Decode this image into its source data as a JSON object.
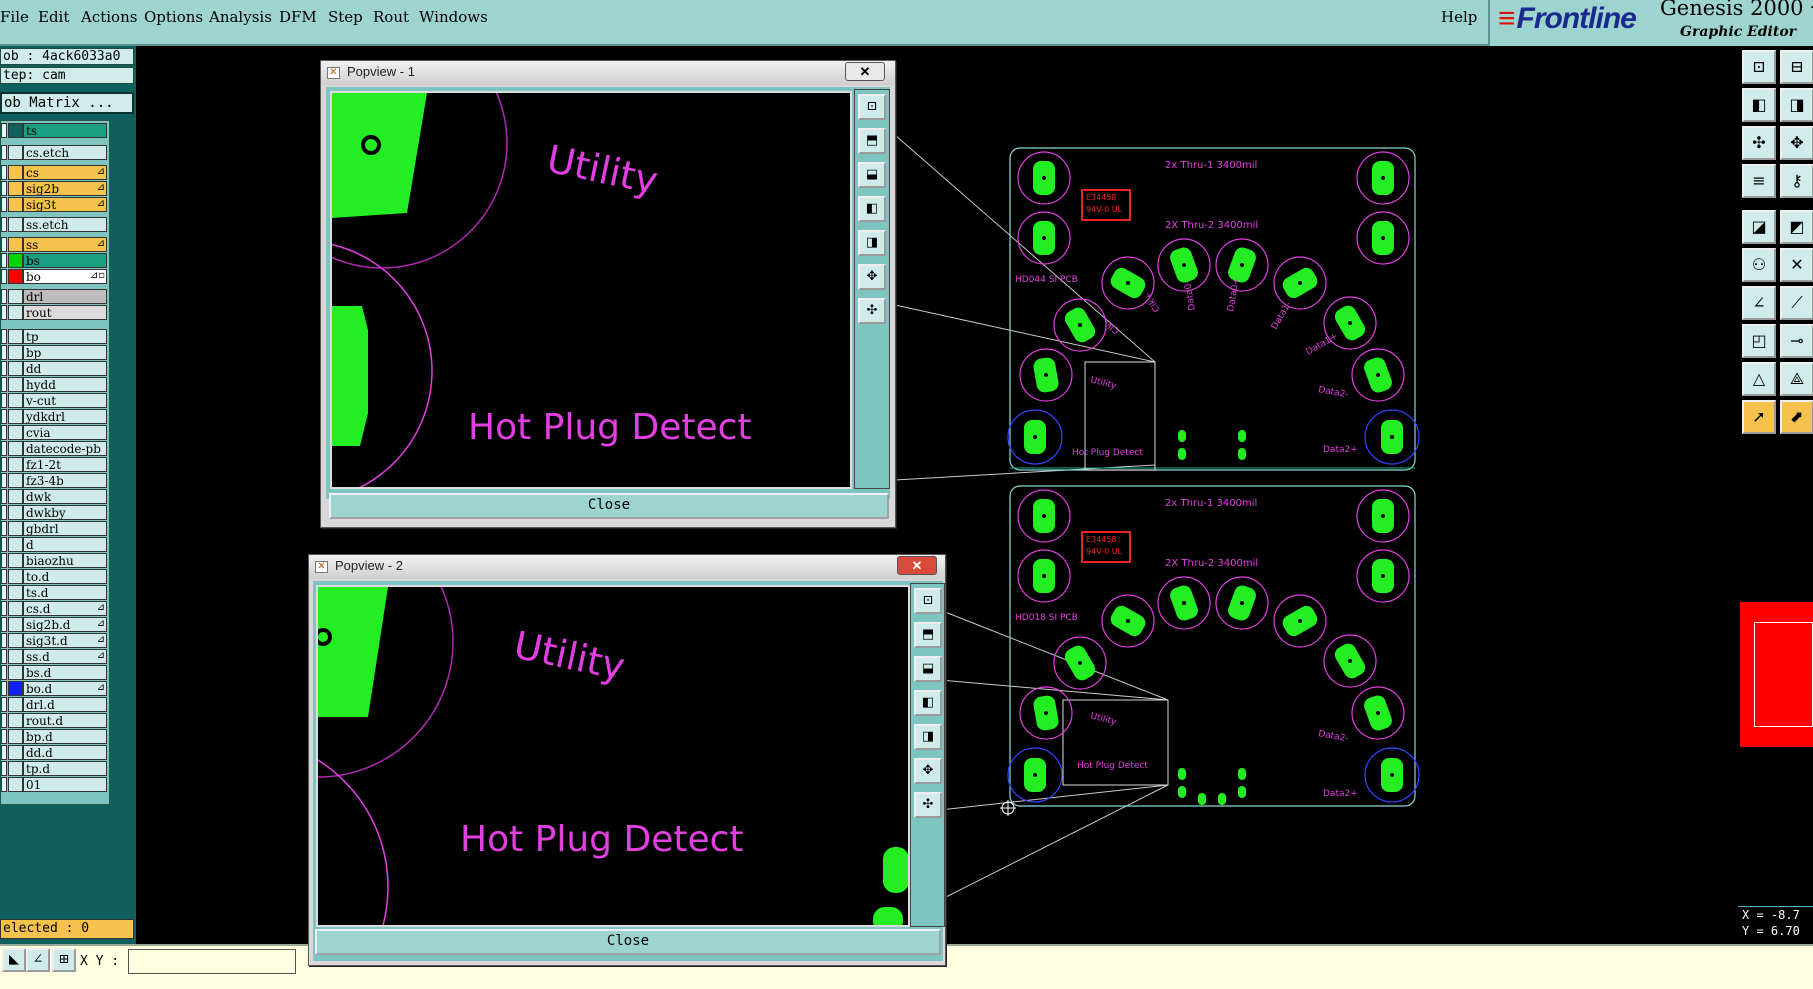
{
  "menu": {
    "items": [
      "File",
      "Edit",
      "Actions",
      "Options",
      "Analysis",
      "DFM",
      "Step",
      "Rout",
      "Windows"
    ],
    "help": "Help"
  },
  "logo": {
    "brand": "Frontline",
    "product": "Genesis 2000",
    "product_suffix": "2",
    "subtitle": "Graphic Editor"
  },
  "left": {
    "job": "ob : 4ack6033a0",
    "step": "tep: cam",
    "job_matrix": "ob Matrix ...",
    "layers": [
      {
        "name": "ts",
        "color": "#0f5f5c",
        "bg": "#1aa080"
      },
      {
        "name": "cs.etch",
        "color": "#cfecea",
        "bg": "#cfecea"
      },
      {
        "name": "cs",
        "color": "#f5c24b",
        "bg": "#f5c24b",
        "mark": "⊿"
      },
      {
        "name": "sig2b",
        "color": "#f5c24b",
        "bg": "#f5c24b",
        "mark": "⊿"
      },
      {
        "name": "sig3t",
        "color": "#f5c24b",
        "bg": "#f5c24b",
        "mark": "⊿"
      },
      {
        "name": "ss.etch",
        "color": "#cfecea",
        "bg": "#cfecea"
      },
      {
        "name": "ss",
        "color": "#f5c24b",
        "bg": "#f5c24b",
        "mark": "⊿"
      },
      {
        "name": "bs",
        "color": "#00d200",
        "bg": "#1aa080"
      },
      {
        "name": "bo",
        "color": "#ff0000",
        "bg": "#ffffff",
        "mark": "⊿▫"
      },
      {
        "name": "drl",
        "color": "#cfecea",
        "bg": "#bdbdbd"
      },
      {
        "name": "rout",
        "color": "#cfecea",
        "bg": "#dcdcdc"
      },
      {
        "name": "tp",
        "color": "#cfecea",
        "bg": "#cfecea"
      },
      {
        "name": "bp",
        "color": "#cfecea",
        "bg": "#cfecea"
      },
      {
        "name": "dd",
        "color": "#cfecea",
        "bg": "#cfecea"
      },
      {
        "name": "hydd",
        "color": "#cfecea",
        "bg": "#cfecea"
      },
      {
        "name": "v-cut",
        "color": "#cfecea",
        "bg": "#cfecea"
      },
      {
        "name": "ydkdrl",
        "color": "#cfecea",
        "bg": "#cfecea"
      },
      {
        "name": "cvia",
        "color": "#cfecea",
        "bg": "#cfecea"
      },
      {
        "name": "datecode-pb",
        "color": "#cfecea",
        "bg": "#cfecea"
      },
      {
        "name": "fz1-2t",
        "color": "#cfecea",
        "bg": "#cfecea"
      },
      {
        "name": "fz3-4b",
        "color": "#cfecea",
        "bg": "#cfecea"
      },
      {
        "name": "dwk",
        "color": "#cfecea",
        "bg": "#cfecea"
      },
      {
        "name": "dwkby",
        "color": "#cfecea",
        "bg": "#cfecea"
      },
      {
        "name": "gbdrl",
        "color": "#cfecea",
        "bg": "#cfecea"
      },
      {
        "name": "d",
        "color": "#cfecea",
        "bg": "#cfecea"
      },
      {
        "name": "biaozhu",
        "color": "#cfecea",
        "bg": "#cfecea"
      },
      {
        "name": "to.d",
        "color": "#cfecea",
        "bg": "#cfecea"
      },
      {
        "name": "ts.d",
        "color": "#cfecea",
        "bg": "#cfecea"
      },
      {
        "name": "cs.d",
        "color": "#cfecea",
        "bg": "#cfecea",
        "mark": "⊿"
      },
      {
        "name": "sig2b.d",
        "color": "#cfecea",
        "bg": "#cfecea",
        "mark": "⊿"
      },
      {
        "name": "sig3t.d",
        "color": "#cfecea",
        "bg": "#cfecea",
        "mark": "⊿"
      },
      {
        "name": "ss.d",
        "color": "#cfecea",
        "bg": "#cfecea",
        "mark": "⊿"
      },
      {
        "name": "bs.d",
        "color": "#cfecea",
        "bg": "#cfecea"
      },
      {
        "name": "bo.d",
        "color": "#1020ff",
        "bg": "#cfecea",
        "mark": "⊿"
      },
      {
        "name": "drl.d",
        "color": "#cfecea",
        "bg": "#cfecea"
      },
      {
        "name": "rout.d",
        "color": "#cfecea",
        "bg": "#cfecea"
      },
      {
        "name": "bp.d",
        "color": "#cfecea",
        "bg": "#cfecea"
      },
      {
        "name": "dd.d",
        "color": "#cfecea",
        "bg": "#cfecea"
      },
      {
        "name": "tp.d",
        "color": "#cfecea",
        "bg": "#cfecea"
      },
      {
        "name": "01",
        "color": "#cfecea",
        "bg": "#cfecea"
      }
    ],
    "selected": "elected : 0"
  },
  "bottom": {
    "xy_label": "X Y :",
    "xy_value": ""
  },
  "coord": {
    "x": "X = -8.7",
    "y": "Y = 6.70"
  },
  "popview1": {
    "title": "Popview - 1",
    "close_x": "✕",
    "close_button": "Close",
    "label_utility": "Utility",
    "label_hpd": "Hot Plug Detect"
  },
  "popview2": {
    "title": "Popview - 2",
    "close_x": "✕",
    "close_button": "Close",
    "label_utility": "Utility",
    "label_hpd": "Hot Plug Detect"
  },
  "board": {
    "top_text": "2x Thru-1 3400mil",
    "mid_text": "2X Thru-2 3400mil",
    "hd_text": "HD044 SI PCB",
    "hd_text2": "HD018 SI PCB",
    "utility": "Utility",
    "hpd": "Hot Plug Detect",
    "data2p": "Data2+",
    "data2m": "Data2-",
    "data1p": "Data1+",
    "data1m": "Data1-",
    "data0p": "Data0+",
    "data0m": "Data0-",
    "clkp": "Clk+",
    "clkm": "Clk-"
  },
  "colors": {
    "pad": "#22ee22",
    "silk": "#e23fe2",
    "outline": "#88d8d8"
  }
}
